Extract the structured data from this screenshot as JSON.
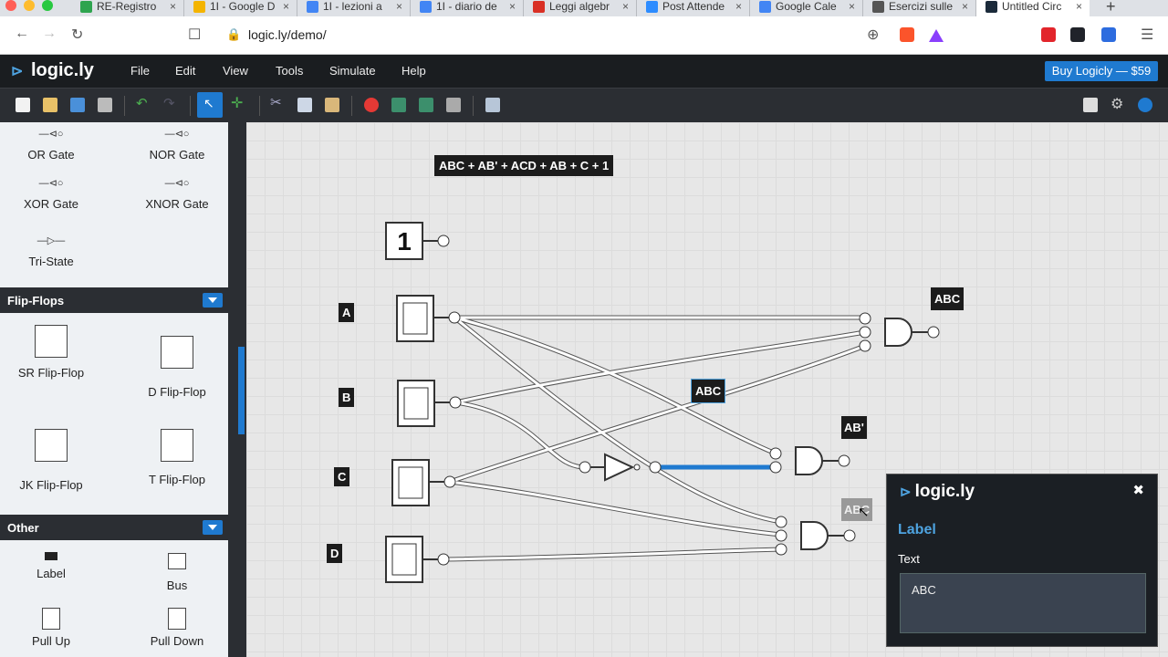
{
  "browser": {
    "tabs": [
      {
        "label": "RE-Registro",
        "icon_color": "#2ea44f"
      },
      {
        "label": "1I - Google D",
        "icon_color": "#f4b400"
      },
      {
        "label": "1I - lezioni a",
        "icon_color": "#4285f4"
      },
      {
        "label": "1I - diario de",
        "icon_color": "#4285f4"
      },
      {
        "label": "Leggi algebr",
        "icon_color": "#d93025"
      },
      {
        "label": "Post Attende",
        "icon_color": "#2d8cff"
      },
      {
        "label": "Google Cale",
        "icon_color": "#4285f4"
      },
      {
        "label": "Esercizi sulle",
        "icon_color": "#555555"
      },
      {
        "label": "Untitled Circ",
        "icon_color": "#1b2a3a"
      }
    ],
    "url": "logic.ly/demo/"
  },
  "app": {
    "logo": "logic.ly",
    "menu": [
      "File",
      "Edit",
      "View",
      "Tools",
      "Simulate",
      "Help"
    ],
    "buy_label": "Buy Logicly — $59"
  },
  "sidebar": {
    "gates": [
      "OR Gate",
      "NOR Gate",
      "XOR Gate",
      "XNOR Gate",
      "Tri-State"
    ],
    "flipflops_title": "Flip-Flops",
    "flipflops": [
      "SR Flip-Flop",
      "D Flip-Flop",
      "JK Flip-Flop",
      "T Flip-Flop"
    ],
    "other_title": "Other",
    "other": [
      "Label",
      "Bus",
      "Pull Up",
      "Pull Down"
    ]
  },
  "canvas": {
    "expression": "ABC + AB' + ACD + AB + C + 1",
    "constant": "1",
    "inputs": [
      "A",
      "B",
      "C",
      "D"
    ],
    "labels": {
      "abc_top": "ABC",
      "abc_mid": "ABC",
      "ab_not": "AB'",
      "abc_ghost": "ABC"
    }
  },
  "inspector": {
    "title": "logic.ly",
    "section": "Label",
    "field": "Text",
    "value": "ABC"
  },
  "colors": {
    "accent": "#1f7ad0",
    "selected_wire": "#1f7ad0"
  }
}
